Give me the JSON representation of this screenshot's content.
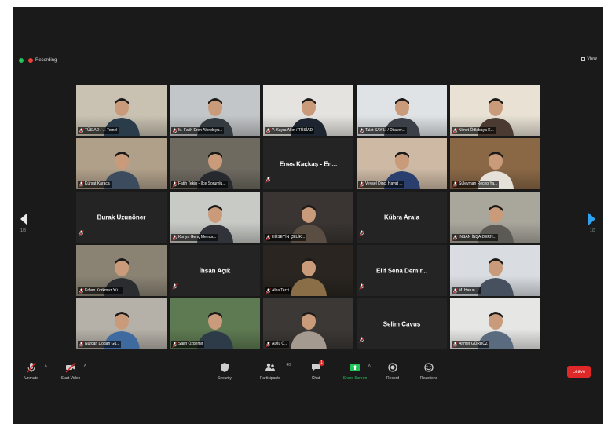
{
  "topbar": {
    "recording_label": "Recording",
    "view_label": "View"
  },
  "pagination": {
    "left": "1/3",
    "right": "1/3"
  },
  "tiles": [
    {
      "caption": "TÜSİAD / ... Temel",
      "video": true,
      "bg": "#c9c2b2",
      "person": "#2a3b4a"
    },
    {
      "caption": "M. Fatih Eren Altındoyu...",
      "video": true,
      "bg": "#c3c6c8",
      "person": "#333a40",
      "active": true
    },
    {
      "caption": "Y. Kayra Akın / TÜSİAD",
      "video": true,
      "bg": "#e4e3df",
      "person": "#1d2530"
    },
    {
      "caption": "Talat SAYILI / Dilaver...",
      "video": true,
      "bg": "#dfe3e6",
      "person": "#3b3f48"
    },
    {
      "caption": "Nimet Ödlabaya K...",
      "video": true,
      "bg": "#e8e1d4",
      "person": "#4a3a32"
    },
    {
      "caption": "Kürşat Karaca",
      "video": true,
      "bg": "#b0a08a",
      "person": "#3c4c5e"
    },
    {
      "caption": "Fatih Tekin - İlçe Sorumlu...",
      "video": true,
      "bg": "#6e6a60",
      "person": "#262a2e"
    },
    {
      "caption": "",
      "video": false,
      "name": "Enes Kaçkaş - En..."
    },
    {
      "caption": "Veysel Dinç, Hayat ...",
      "video": true,
      "bg": "#cdb9a4",
      "person": "#2b3f6e"
    },
    {
      "caption": "Süleyman Recep Ya...",
      "video": true,
      "bg": "#8a6846",
      "person": "#e6e1d8"
    },
    {
      "caption": "",
      "video": false,
      "name": "Burak Uzunöner"
    },
    {
      "caption": "Konya Genç Memur...",
      "video": true,
      "bg": "#c8cac6",
      "person": "#30343a"
    },
    {
      "caption": "HÜSEYİN ÇELİK...",
      "video": true,
      "bg": "#3a3532",
      "person": "#5a4d42"
    },
    {
      "caption": "",
      "video": false,
      "name": "Kübra Arala"
    },
    {
      "caption": "İNSAN İNŞA DERN...",
      "video": true,
      "bg": "#a9a79c",
      "person": "#5b5a55"
    },
    {
      "caption": "Erhan Korkmaz Yü...",
      "video": true,
      "bg": "#8a8374",
      "person": "#2a2c30"
    },
    {
      "caption": "",
      "video": false,
      "name": "İhsan Açık"
    },
    {
      "caption": "Alha Terzi",
      "video": true,
      "bg": "#2a2520",
      "person": "#8a6e48"
    },
    {
      "caption": "",
      "video": false,
      "name": "Elif Sena Demir..."
    },
    {
      "caption": "M. Harun ...",
      "video": true,
      "bg": "#d9dde2",
      "person": "#46505e"
    },
    {
      "caption": "Nurcan Doğan Gü...",
      "video": true,
      "bg": "#b6b1a8",
      "person": "#3f6aa0"
    },
    {
      "caption": "Salih Özdemir",
      "video": true,
      "bg": "#5e7a52",
      "person": "#2d3a48"
    },
    {
      "caption": "ADİL Ö...",
      "video": true,
      "bg": "#3b3835",
      "person": "#a49a90"
    },
    {
      "caption": "",
      "video": false,
      "name": "Selim Çavuş"
    },
    {
      "caption": "Ahmet GÜRBÜZ",
      "video": true,
      "bg": "#e6e6e4",
      "person": "#5a6b80"
    }
  ],
  "toolbar": {
    "unmute": "Unmute",
    "start_video": "Start Video",
    "security": "Security",
    "participants": "Participants",
    "participants_count": "40",
    "chat": "Chat",
    "chat_badge": "1",
    "share_screen": "Share Screen",
    "record": "Record",
    "reactions": "Reactions",
    "leave": "Leave"
  },
  "colors": {
    "active_speaker": "#c8d93c",
    "share_screen": "#23c45a",
    "leave": "#e02828",
    "next_arrow": "#2da2f0"
  }
}
